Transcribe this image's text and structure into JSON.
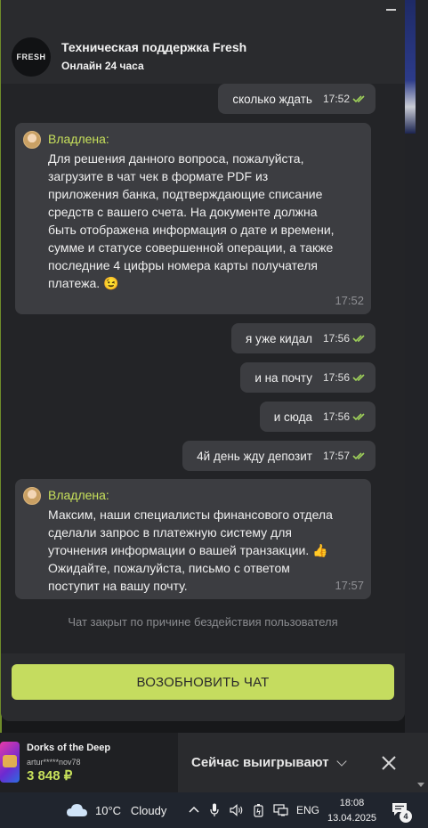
{
  "header": {
    "logo_text": "FRESH",
    "title": "Техническая поддержка Fresh",
    "subtitle": "Онлайн 24 часа"
  },
  "messages": [
    {
      "type": "out",
      "text": "сколько ждать",
      "time": "17:52"
    },
    {
      "type": "in",
      "name": "Владлена:",
      "text": "Для решения данного вопроса, пожалуйста, загрузите в чат чек в формате PDF из приложения банка, подтверждающие списание средств с вашего счета. На документе должна быть отображена информация о дате и времени, сумме и статусе совершенной операции, а также последние 4 цифры номера карты получателя платежа. 😉",
      "time": "17:52"
    },
    {
      "type": "out",
      "text": "я уже кидал",
      "time": "17:56"
    },
    {
      "type": "out",
      "text": "и на почту",
      "time": "17:56"
    },
    {
      "type": "out",
      "text": "и сюда",
      "time": "17:56"
    },
    {
      "type": "out",
      "text": "4й день жду депозит",
      "time": "17:57"
    },
    {
      "type": "in",
      "name": "Владлена:",
      "text": "Максим, наши специалисты финансового отдела сделали запрос в платежную систему для уточнения информации о вашей транзакции. 👍 Ожидайте, пожалуйста, письмо с ответом поступит на вашу почту.",
      "time": "17:57"
    }
  ],
  "chat_closed_note": "Чат закрыт по причине бездействия пользователя",
  "resume_button": "ВОЗОБНОВИТЬ ЧАТ",
  "winners_bar": {
    "game_title": "Dorks of the Deep",
    "user": "artur*****nov78",
    "amount": "3 848 ₽",
    "label": "Сейчас выигрывают"
  },
  "taskbar": {
    "temperature": "10°C",
    "weather": "Cloudy",
    "language": "ENG",
    "time": "18:08",
    "date": "13.04.2025",
    "notifications": "4"
  },
  "colors": {
    "accent": "#c5dc5f",
    "bubble": "#3c3d41",
    "chat_bg": "#232427",
    "read_tick": "#9fd15a"
  }
}
